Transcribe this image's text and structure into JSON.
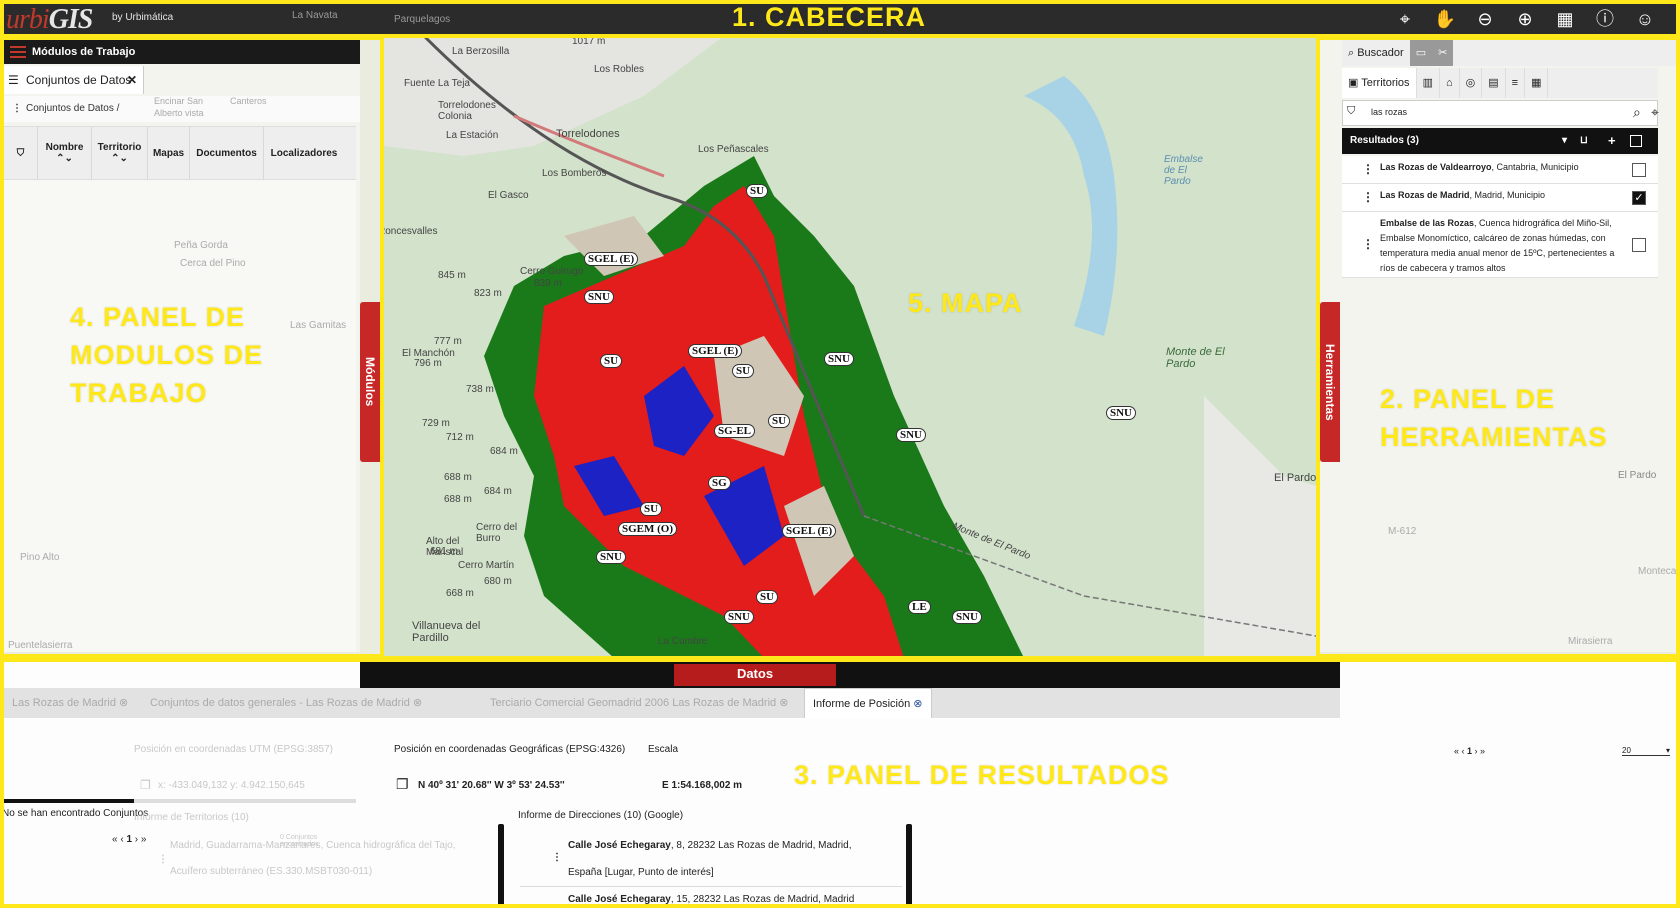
{
  "header": {
    "logo_urbi": "urbi",
    "logo_gis": "GIS",
    "logo_by": "by Urbimática",
    "annotation": "1. CABECERA",
    "map_labels": [
      "La Navata",
      "Parquelagos"
    ]
  },
  "left_panel": {
    "title": "Módulos de Trabajo",
    "tab_label": "Conjuntos de Datos",
    "breadcrumb": "Conjuntos de Datos /",
    "columns": [
      "Nombre",
      "Territorio",
      "Mapas",
      "Documentos",
      "Localizadores"
    ],
    "side_tab": "Módulos",
    "annotation_lines": [
      "4. PANEL DE",
      "MODULOS DE",
      "TRABAJO"
    ],
    "bg_labels": [
      "Encinar San",
      "Alberto vista",
      "Canteros",
      "Peña Gorda",
      "Cerca del Pino",
      "Las Gamitas",
      "Pino Alto",
      "Puentelasierra"
    ]
  },
  "map": {
    "annotation": "5. MAPA",
    "place_labels": [
      "La Berzosilla",
      "Los Robles",
      "Fuente La Teja",
      "Torrelodones Colonia",
      "La Estación",
      "Torrelodones",
      "Los Peñascales",
      "Los Bomberos",
      "El Gasco",
      "Roncesvalles",
      "Cerro Guirugo",
      "El Manchón",
      "Alto del Mariscal",
      "Cerro del Burro",
      "Cerro Martín",
      "Villanueva del Pardillo",
      "La Cumbre",
      "Embalse de El Pardo",
      "Monte de El Pardo",
      "El Pardo",
      "Monte de El Pardo"
    ],
    "elevations": [
      "1017 m",
      "845 m",
      "823 m",
      "839 m",
      "777 m",
      "796 m",
      "738 m",
      "729 m",
      "712 m",
      "684 m",
      "688 m",
      "688 m",
      "684 m",
      "681 m",
      "680 m",
      "668 m"
    ],
    "zones": [
      "SU",
      "SGEL (E)",
      "SNU",
      "SU",
      "SGEL (E)",
      "SU",
      "SG-EL",
      "SU",
      "SG",
      "SU",
      "SGEM (O)",
      "SGEL (E)",
      "SNU",
      "SNU",
      "SNU",
      "SNU",
      "SU",
      "SNU",
      "SNU",
      "LE"
    ]
  },
  "right_panel": {
    "buscador_label": "Buscador",
    "territorios_tab": "Territorios",
    "search_value": "las rozas",
    "results_label": "Resultados (3)",
    "side_tab": "Herramientas",
    "annotation_lines": [
      "2. PANEL DE",
      "HERRAMIENTAS"
    ],
    "results": [
      {
        "name": "Las Rozas de Valdearroyo",
        "detail": ", Cantabria, Municipio",
        "checked": false
      },
      {
        "name": "Las Rozas de Madrid",
        "detail": ", Madrid, Municipio",
        "checked": true
      },
      {
        "name": "Embalse de las Rozas",
        "detail": ", Cuenca hidrográfica del Miño-Sil, Embalse Monomíctico, calcáreo de zonas húmedas, con temperatura media anual menor de 15ºC, pertenecientes a ríos de cabecera y tramos altos",
        "checked": false
      }
    ],
    "bg_labels": [
      "El Pardo",
      "M-612",
      "Montecar",
      "Mirasierra"
    ]
  },
  "bottom": {
    "datos_label": "Datos",
    "annotation": "3. PANEL DE RESULTADOS",
    "tabs": [
      "Las Rozas de Madrid",
      "Conjuntos de datos generales - Las Rozas de Madrid",
      "Terciario Comercial Geomadrid 2006 Las Rozas de Madrid",
      "Informe de Posición"
    ],
    "utm_label": "Posición en coordenadas UTM (EPSG:3857)",
    "utm_value": "x: -433.049,132 y: 4.942.150,645",
    "geo_label": "Posición en coordenadas Geográficas (EPSG:4326)",
    "geo_value": "N 40º 31' 20.68'' W 3º 53' 24.53''",
    "scale_label": "Escala",
    "scale_value": "E 1:54.168,002 m",
    "no_conjuntos": "No se han encontrado Conjuntos",
    "territorios_info": "Informe de Territorios (10)",
    "page_num": "1",
    "conjuntos_small": "0 Conjuntos encontrados",
    "terr_row1": "Madrid, Guadarrama-Manzanares, Cuenca hidrográfica del Tajo,",
    "terr_row2": "Acuífero subterráneo (ES.330.MSBT030-011)",
    "dir_label": "Informe de Direcciones (10) (Google)",
    "dir_rows": [
      {
        "street": "Calle José Echegaray",
        "rest": ", 8, 28232 Las Rozas de Madrid, Madrid,",
        "line2": "España [Lugar, Punto de interés]"
      },
      {
        "street": "Calle José Echegaray",
        "rest": ", 15, 28232 Las Rozas de Madrid, Madrid",
        "line2": ""
      }
    ],
    "right_pager": "1",
    "page_size": "20"
  }
}
